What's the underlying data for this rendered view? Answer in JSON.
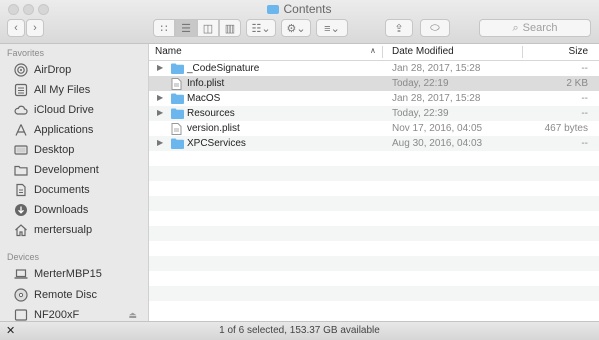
{
  "window": {
    "title": "Contents"
  },
  "toolbar": {
    "search_placeholder": "Search"
  },
  "sidebar": {
    "favorites_header": "Favorites",
    "favorites": [
      {
        "label": "AirDrop",
        "icon": "airdrop-icon"
      },
      {
        "label": "All My Files",
        "icon": "all-files-icon"
      },
      {
        "label": "iCloud Drive",
        "icon": "cloud-icon"
      },
      {
        "label": "Applications",
        "icon": "applications-icon"
      },
      {
        "label": "Desktop",
        "icon": "desktop-icon"
      },
      {
        "label": "Development",
        "icon": "folder-icon"
      },
      {
        "label": "Documents",
        "icon": "documents-icon"
      },
      {
        "label": "Downloads",
        "icon": "downloads-icon"
      },
      {
        "label": "mertersualp",
        "icon": "home-icon"
      }
    ],
    "devices_header": "Devices",
    "devices": [
      {
        "label": "MerterMBP15",
        "icon": "laptop-icon"
      },
      {
        "label": "Remote Disc",
        "icon": "disc-icon"
      },
      {
        "label": "NF200xF",
        "icon": "drive-icon"
      }
    ]
  },
  "columns": {
    "name": "Name",
    "date": "Date Modified",
    "size": "Size"
  },
  "files": [
    {
      "name": "_CodeSignature",
      "date": "Jan 28, 2017, 15:28",
      "size": "--",
      "kind": "folder"
    },
    {
      "name": "Info.plist",
      "date": "Today, 22:19",
      "size": "2 KB",
      "kind": "file"
    },
    {
      "name": "MacOS",
      "date": "Jan 28, 2017, 15:28",
      "size": "--",
      "kind": "folder"
    },
    {
      "name": "Resources",
      "date": "Today, 22:39",
      "size": "--",
      "kind": "folder"
    },
    {
      "name": "version.plist",
      "date": "Nov 17, 2016, 04:05",
      "size": "467 bytes",
      "kind": "file"
    },
    {
      "name": "XPCServices",
      "date": "Aug 30, 2016, 04:03",
      "size": "--",
      "kind": "folder"
    }
  ],
  "status": {
    "text": "1 of 6 selected, 153.37 GB available"
  },
  "colors": {
    "folder": "#6bb6ec",
    "selection": "#dcdcdc",
    "sidebar": "#e9e9e9"
  }
}
